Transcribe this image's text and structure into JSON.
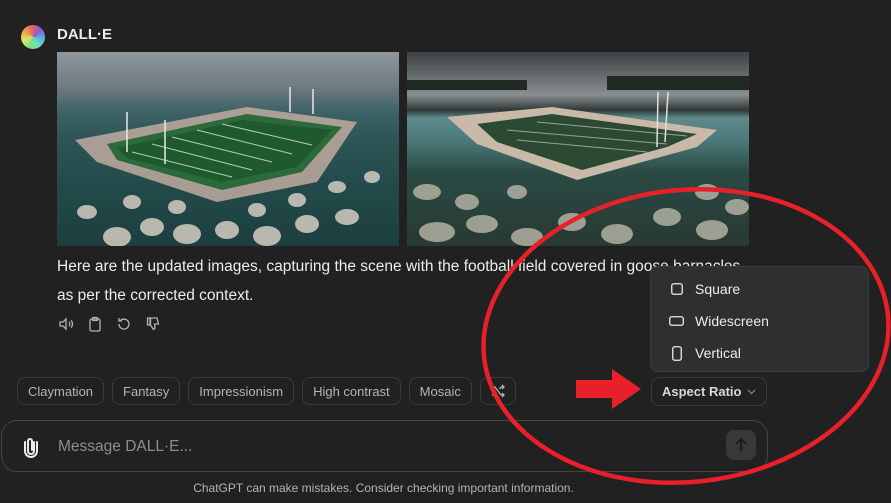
{
  "message": {
    "sender": "DALL·E",
    "images": [
      {
        "alt": "Football field surrounded by goose barnacles floating in the sea, overcast sky"
      },
      {
        "alt": "Football field ringed with goose barnacles in a lake with forested shoreline, stormy sky"
      }
    ],
    "text": "Here are the updated images, capturing the scene with the football field covered in goose barnacles, as per the corrected context.",
    "actions": [
      {
        "icon": "speaker-icon",
        "label": "Read aloud"
      },
      {
        "icon": "clipboard-icon",
        "label": "Copy"
      },
      {
        "icon": "regenerate-icon",
        "label": "Regenerate"
      },
      {
        "icon": "thumbs-down-icon",
        "label": "Bad response"
      }
    ]
  },
  "style_chips": [
    "Claymation",
    "Fantasy",
    "Impressionism",
    "High contrast",
    "Mosaic"
  ],
  "shuffle": {
    "icon": "shuffle-icon"
  },
  "aspect_ratio": {
    "label": "Aspect Ratio",
    "icon": "chevron-down-icon",
    "options": [
      {
        "label": "Square",
        "icon": "square-icon"
      },
      {
        "label": "Widescreen",
        "icon": "widescreen-icon"
      },
      {
        "label": "Vertical",
        "icon": "vertical-icon"
      }
    ]
  },
  "composer": {
    "placeholder": "Message DALL·E...",
    "value": "",
    "attach_icon": "paperclip-icon",
    "send_icon": "arrow-up-icon"
  },
  "disclaimer": "ChatGPT can make mistakes. Consider checking important information.",
  "annotation": {
    "color": "#e8202a",
    "shapes": [
      "ellipse",
      "arrow"
    ]
  }
}
